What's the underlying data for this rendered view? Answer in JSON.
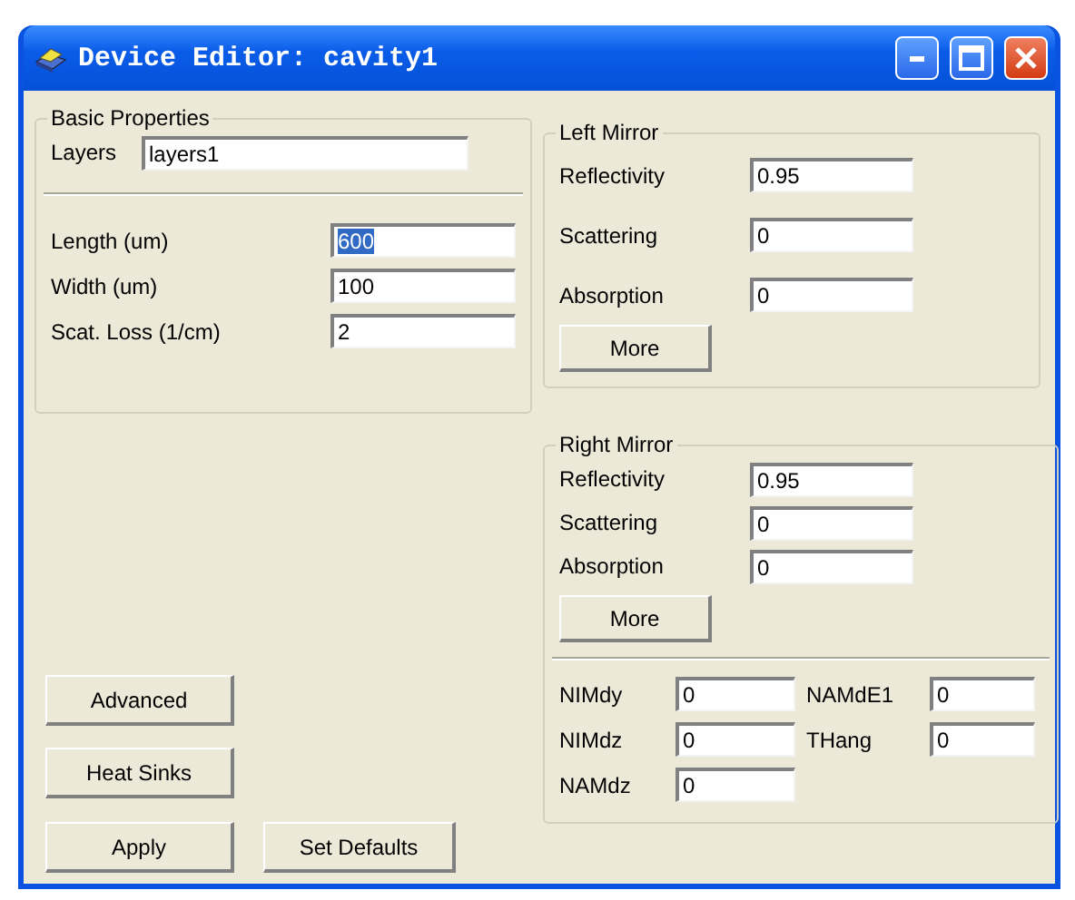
{
  "window": {
    "title": "Device Editor: cavity1"
  },
  "basic_properties": {
    "title": "Basic Properties",
    "layers": {
      "label": "Layers",
      "value": "layers1"
    },
    "fields": [
      {
        "label": "Length (um)",
        "value": "600",
        "highlighted": true
      },
      {
        "label": "Width (um)",
        "value": "100",
        "highlighted": false
      },
      {
        "label": "Scat. Loss (1/cm)",
        "value": "2",
        "highlighted": false
      }
    ]
  },
  "left_mirror": {
    "title": "Left Mirror",
    "fields": [
      {
        "label": "Reflectivity",
        "value": "0.95"
      },
      {
        "label": "Scattering",
        "value": "0"
      },
      {
        "label": "Absorption",
        "value": "0"
      }
    ],
    "button": "More"
  },
  "right_mirror": {
    "title": "Right Mirror",
    "fields": [
      {
        "label": "Reflectivity",
        "value": "0.95"
      },
      {
        "label": "Scattering",
        "value": "0"
      },
      {
        "label": "Absorption",
        "value": "0"
      }
    ],
    "button": "More",
    "extra_left": [
      {
        "label": "NIMdy",
        "value": "0"
      },
      {
        "label": "NIMdz",
        "value": "0"
      },
      {
        "label": "NAMdz",
        "value": "0"
      }
    ],
    "extra_right": [
      {
        "label": "NAMdE1",
        "value": "0"
      },
      {
        "label": "THang",
        "value": "0"
      }
    ]
  },
  "buttons": {
    "advanced": "Advanced",
    "heat_sinks": "Heat Sinks",
    "apply": "Apply",
    "set_defaults": "Set Defaults"
  }
}
